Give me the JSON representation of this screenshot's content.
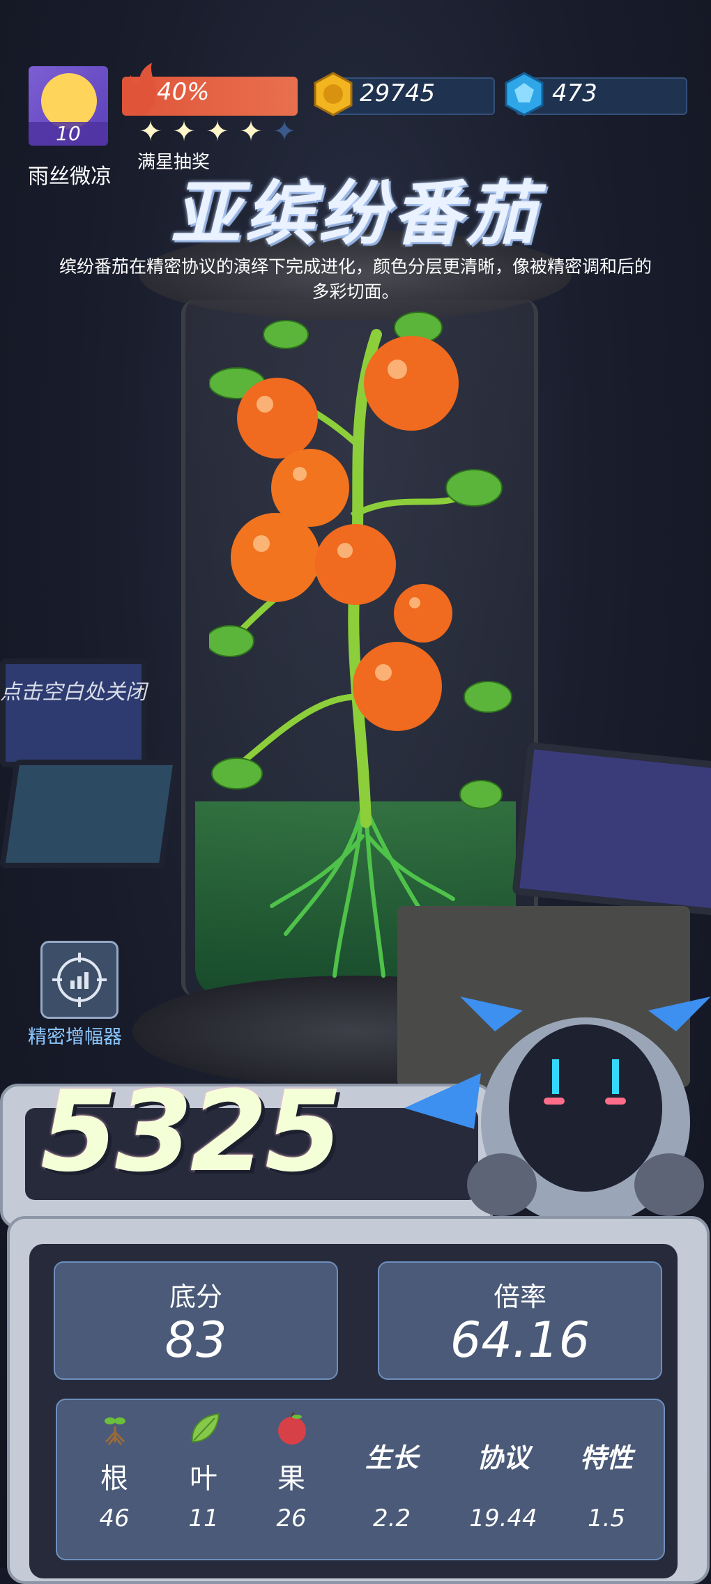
{
  "player": {
    "name": "雨丝微凉",
    "level": "10"
  },
  "star_progress": {
    "percent_text": "40%",
    "filled_stars": 4,
    "total_stars": 5,
    "label": "满星抽奖"
  },
  "resources": {
    "coins": "29745",
    "gems": "473"
  },
  "item": {
    "title": "亚缤纷番茄",
    "description": "缤纷番茄在精密协议的演绎下完成进化，颜色分层更清晰，像被精密调和后的多彩切面。"
  },
  "hints": {
    "close": "点击空白处关闭"
  },
  "amplifier": {
    "label": "精密增幅器"
  },
  "score": {
    "total": "5325",
    "base_label": "底分",
    "base_value": "83",
    "rate_label": "倍率",
    "rate_value": "64.16"
  },
  "attributes": [
    {
      "name": "根",
      "value": "46",
      "icon": "root-icon"
    },
    {
      "name": "叶",
      "value": "11",
      "icon": "leaf-icon"
    },
    {
      "name": "果",
      "value": "26",
      "icon": "fruit-icon"
    },
    {
      "name": "生长",
      "value": "2.2"
    },
    {
      "name": "协议",
      "value": "19.44"
    },
    {
      "name": "特性",
      "value": "1.5"
    }
  ],
  "colors": {
    "accent_blue": "#8cc7ff",
    "flame": "#e0553a",
    "panel": "#4a5a78"
  }
}
